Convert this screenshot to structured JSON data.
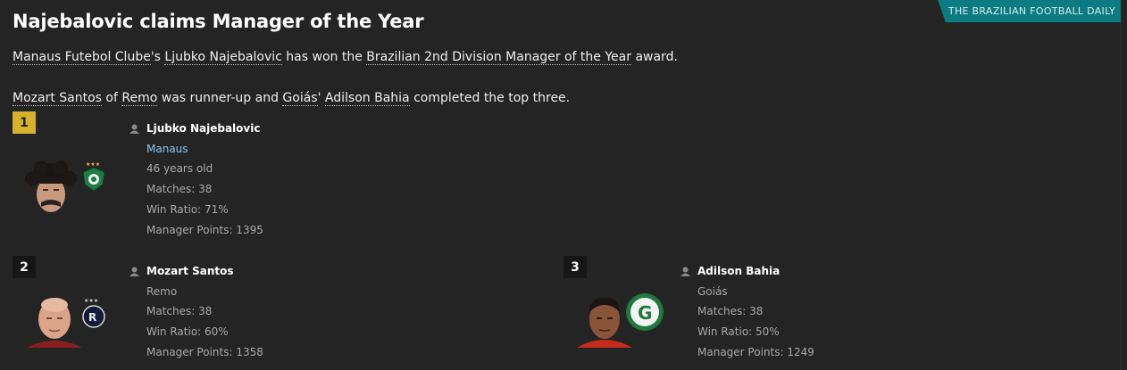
{
  "source": "THE BRAZILIAN FOOTBALL DAILY",
  "headline": "Najebalovic claims Manager of the Year",
  "paragraph1": {
    "club": "Manaus Futebol Clube",
    "possessive": "'s ",
    "manager": "Ljubko Najebalovic",
    "mid": " has won the ",
    "award": "Brazilian 2nd Division Manager of the Year",
    "end": " award."
  },
  "paragraph2": {
    "second_manager": "Mozart Santos",
    "of": " of ",
    "second_club": "Remo",
    "mid": " was runner-up and ",
    "third_club": "Goiás",
    "possessive": "' ",
    "third_manager": "Adilson Bahia",
    "end": " completed the top three."
  },
  "winners": [
    {
      "rank": "1",
      "name": "Ljubko Najebalovic",
      "club": "Manaus",
      "age": "46 years old",
      "matches": "Matches: 38",
      "win_ratio": "Win Ratio: 71%",
      "points": "Manager Points: 1395",
      "rank_color": "#d7b12d"
    },
    {
      "rank": "2",
      "name": "Mozart Santos",
      "club": "Remo",
      "matches": "Matches: 38",
      "win_ratio": "Win Ratio: 60%",
      "points": "Manager Points: 1358"
    },
    {
      "rank": "3",
      "name": "Adilson Bahia",
      "club": "Goiás",
      "matches": "Matches: 38",
      "win_ratio": "Win Ratio: 50%",
      "points": "Manager Points: 1249"
    }
  ],
  "icons": {
    "person": "person-icon",
    "crest1": "manaus-crest-icon",
    "crest2": "remo-crest-icon",
    "crest3": "goias-crest-icon"
  },
  "colors": {
    "accent": "#0c7b82",
    "gold": "#d7b12d",
    "link": "#8cc3ef",
    "background": "#242424"
  }
}
